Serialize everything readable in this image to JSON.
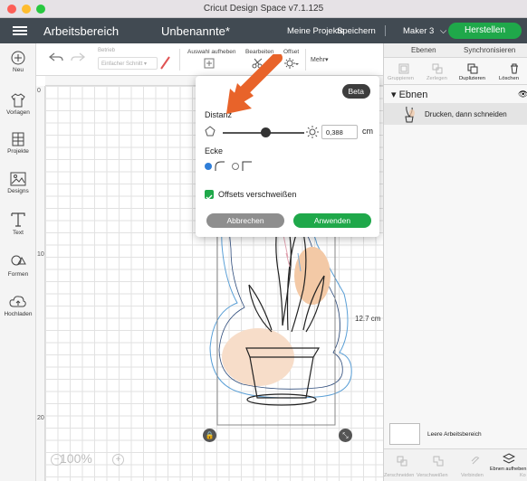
{
  "window": {
    "title": "Cricut Design Space  v7.1.125"
  },
  "header": {
    "area_title": "Arbeitsbereich",
    "project_title": "Unbenannte*",
    "my_projects": "Meine Projekte",
    "save": "Speichern",
    "machine": "Maker 3",
    "make": "Herstellen"
  },
  "leftnav": {
    "items": [
      {
        "label": "Neu",
        "icon": "plus-circle-icon"
      },
      {
        "label": "Vorlagen",
        "icon": "shirt-icon"
      },
      {
        "label": "Projekte",
        "icon": "grid-bookmark-icon"
      },
      {
        "label": "Designs",
        "icon": "image-icon"
      },
      {
        "label": "Text",
        "icon": "text-t-icon"
      },
      {
        "label": "Formen",
        "icon": "shapes-icon"
      },
      {
        "label": "Hochladen",
        "icon": "cloud-upload-icon"
      }
    ]
  },
  "toolbar": {
    "operation_label": "Betrieb",
    "operation_value": "Einfacher Schnitt",
    "deselect": "Auswahl aufheben",
    "edit": "Bearbeiten",
    "offset": "Offset",
    "more": "Mehr"
  },
  "offset_popup": {
    "badge": "Beta",
    "distance_label": "Distanz",
    "distance_value": "0,388",
    "unit": "cm",
    "distance_fraction": 0.47,
    "corner_label": "Ecke",
    "corner_selected": "rounded",
    "weld_label": "Offsets verschweißen",
    "weld_checked": true,
    "cancel": "Abbrechen",
    "apply": "Anwenden"
  },
  "canvas": {
    "ruler_left_ticks": [
      "0",
      "10",
      "20"
    ],
    "dimension_label": "12.7 cm",
    "zoom": "100%"
  },
  "right_panel": {
    "tabs": [
      "Ebenen",
      "Synchronisieren"
    ],
    "tools": [
      "Gruppieren",
      "Zerlegen",
      "Duplizieren",
      "Löschen"
    ],
    "layers_heading": "Ebnen",
    "layer_name": "Drucken, dann schneiden",
    "blank_canvas": "Leere Arbeitsbereich",
    "bottom_tools": [
      "Zerschneiden",
      "Verschweißen",
      "Verbinden",
      "Ebnen aufheben",
      "Ko"
    ]
  },
  "colors": {
    "header_bg": "#414a52",
    "accent_green": "#1fa84a",
    "arrow_orange": "#e8632a"
  }
}
